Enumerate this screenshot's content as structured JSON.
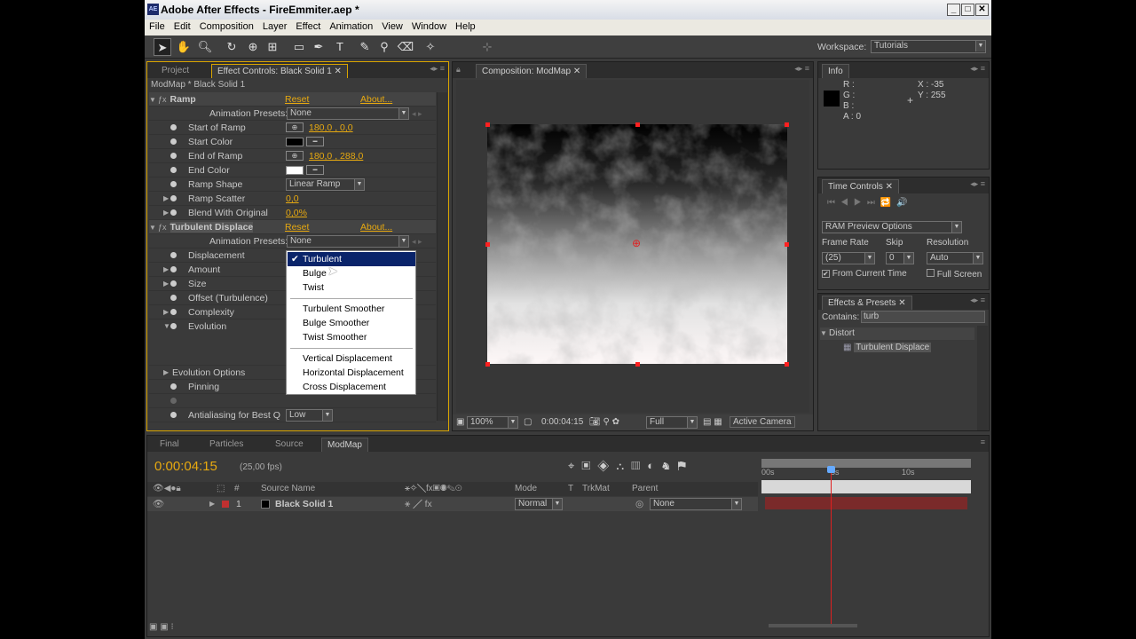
{
  "window": {
    "title": "Adobe After Effects - FireEmmiter.aep *",
    "app_icon": "AE"
  },
  "menu": [
    "File",
    "Edit",
    "Composition",
    "Layer",
    "Effect",
    "Animation",
    "View",
    "Window",
    "Help"
  ],
  "workspace": {
    "label": "Workspace:",
    "value": "Tutorials"
  },
  "effect_controls": {
    "tabs": [
      "Project",
      "Effect Controls: Black Solid 1"
    ],
    "breadcrumb": "ModMap * Black Solid 1",
    "ramp": {
      "name": "Ramp",
      "reset": "Reset",
      "about": "About...",
      "presets_label": "Animation Presets:",
      "presets_value": "None",
      "props": [
        {
          "label": "Start of Ramp",
          "value": "180,0 , 0,0"
        },
        {
          "label": "Start Color",
          "value": ""
        },
        {
          "label": "End of Ramp",
          "value": "180,0 , 288,0"
        },
        {
          "label": "End Color",
          "value": ""
        },
        {
          "label": "Ramp Shape",
          "value": "Linear Ramp"
        },
        {
          "label": "Ramp Scatter",
          "value": "0,0"
        },
        {
          "label": "Blend With Original",
          "value": "0,0%"
        }
      ]
    },
    "turbulent": {
      "name": "Turbulent Displace",
      "reset": "Reset",
      "about": "About...",
      "presets_label": "Animation Presets:",
      "presets_value": "None",
      "props": [
        "Displacement",
        "Amount",
        "Size",
        "Offset (Turbulence)",
        "Complexity",
        "Evolution",
        "Evolution Options",
        "Pinning",
        "",
        "Antialiasing for Best Q"
      ],
      "antialias_value": "Low"
    }
  },
  "displacement_menu": {
    "group1": [
      "Turbulent",
      "Bulge",
      "Twist"
    ],
    "group2": [
      "Turbulent Smoother",
      "Bulge Smoother",
      "Twist Smoother"
    ],
    "group3": [
      "Vertical Displacement",
      "Horizontal Displacement",
      "Cross Displacement"
    ],
    "selected": "Turbulent",
    "check": "✔"
  },
  "composition": {
    "tab": "Composition: ModMap",
    "zoom": "100%",
    "timecode": "0:00:04:15",
    "resolution": "Full",
    "camera": "Active Camera"
  },
  "info": {
    "tab": "Info",
    "r": "R :",
    "g": "G :",
    "b": "B :",
    "a": "A : 0",
    "x": "X : -35",
    "y": "Y : 255"
  },
  "time_controls": {
    "tab": "Time Controls",
    "ram_preview": "RAM Preview Options",
    "frame_rate_label": "Frame Rate",
    "skip_label": "Skip",
    "resolution_label": "Resolution",
    "frame_rate": "(25)",
    "skip": "0",
    "resolution": "Auto",
    "from_current": "From Current Time",
    "full_screen": "Full Screen"
  },
  "effects_presets": {
    "tab": "Effects & Presets",
    "contains_label": "Contains:",
    "search": "turb",
    "category": "Distort",
    "item": "Turbulent Displace"
  },
  "timeline": {
    "tabs": [
      "Final",
      "Particles",
      "Source",
      "ModMap"
    ],
    "timecode": "0:00:04:15",
    "fps": "(25,00 fps)",
    "headers": {
      "num": "#",
      "source": "Source Name",
      "mode": "Mode",
      "t": "T",
      "trkmat": "TrkMat",
      "parent": "Parent"
    },
    "layer": {
      "num": "1",
      "name": "Black Solid 1",
      "mode": "Normal",
      "parent": "None"
    },
    "ruler": [
      "00s",
      "5s",
      "10s"
    ]
  }
}
